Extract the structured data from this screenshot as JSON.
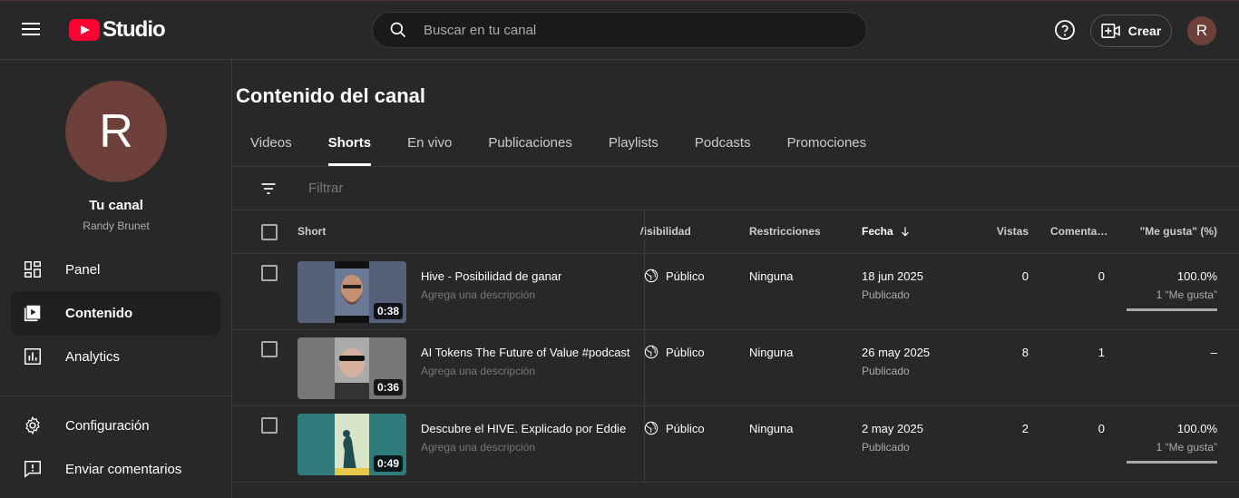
{
  "header": {
    "logo_text": "Studio",
    "search_placeholder": "Buscar en tu canal",
    "create_label": "Crear",
    "avatar_letter": "R"
  },
  "sidebar": {
    "avatar_letter": "R",
    "channel_title": "Tu canal",
    "channel_name": "Randy Brunet",
    "items": [
      {
        "label": "Panel"
      },
      {
        "label": "Contenido"
      },
      {
        "label": "Analytics"
      },
      {
        "label": "Configuración"
      },
      {
        "label": "Enviar comentarios"
      }
    ]
  },
  "main": {
    "title": "Contenido del canal",
    "tabs": [
      {
        "label": "Videos"
      },
      {
        "label": "Shorts"
      },
      {
        "label": "En vivo"
      },
      {
        "label": "Publicaciones"
      },
      {
        "label": "Playlists"
      },
      {
        "label": "Podcasts"
      },
      {
        "label": "Promociones"
      }
    ],
    "filter_placeholder": "Filtrar",
    "columns": {
      "short": "Short",
      "visibility": "Visibilidad",
      "restrictions": "Restricciones",
      "date": "Fecha",
      "views": "Vistas",
      "comments": "Comenta…",
      "likes": "\"Me gusta\" (%)"
    },
    "rows": [
      {
        "title": "Hive - Posibilidad de ganar",
        "description": "Agrega una descripción",
        "duration": "0:38",
        "visibility": "Público",
        "restrictions": "Ninguna",
        "date": "18 jun 2025",
        "status": "Publicado",
        "views": "0",
        "comments": "0",
        "likes_pct": "100.0%",
        "likes_count": "1 “Me gusta”",
        "likes_fraction": 1.0
      },
      {
        "title": "AI Tokens The Future of Value #podcast",
        "description": "Agrega una descripción",
        "duration": "0:36",
        "visibility": "Público",
        "restrictions": "Ninguna",
        "date": "26 may 2025",
        "status": "Publicado",
        "views": "8",
        "comments": "1",
        "likes_pct": "–",
        "likes_count": "",
        "likes_fraction": null
      },
      {
        "title": "Descubre el HIVE. Explicado por Eddie",
        "description": "Agrega una descripción",
        "duration": "0:49",
        "visibility": "Público",
        "restrictions": "Ninguna",
        "date": "2 may 2025",
        "status": "Publicado",
        "views": "2",
        "comments": "0",
        "likes_pct": "100.0%",
        "likes_count": "1 “Me gusta”",
        "likes_fraction": 1.0
      }
    ]
  }
}
